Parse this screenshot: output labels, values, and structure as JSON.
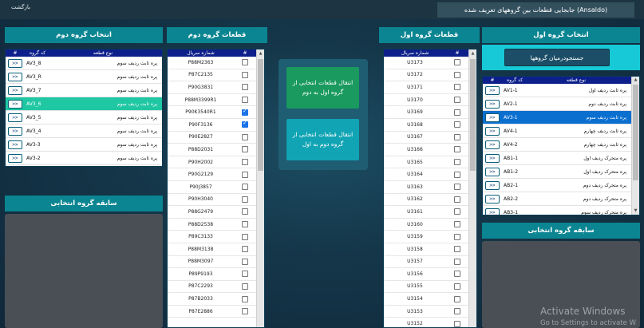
{
  "topbar": {
    "back": "بازگشت",
    "title": "جابجایی قطعات بین گروههای تعریف شده (Ansaldo)"
  },
  "left_group": {
    "header": "انتخاب گروه دوم",
    "columns": [
      "#",
      "کد گروه",
      "نوع قطعه"
    ],
    "rows": [
      {
        "btn": ">>",
        "code": "AV3_8",
        "name": "پره ثابت ردیف سوم"
      },
      {
        "btn": ">>",
        "code": "AV3_R",
        "name": "پره ثابت ردیف سوم"
      },
      {
        "btn": ">>",
        "code": "AV3_7",
        "name": "پره ثابت ردیف سوم"
      },
      {
        "btn": ">>",
        "code": "AV3_6",
        "name": "پره ثابت ردیف سوم"
      },
      {
        "btn": ">>",
        "code": "AV3_5",
        "name": "پره ثابت ردیف سوم"
      },
      {
        "btn": ">>",
        "code": "AV3_4",
        "name": "پره ثابت ردیف سوم"
      },
      {
        "btn": ">>",
        "code": "AV3-3",
        "name": "پره ثابت ردیف سوم"
      },
      {
        "btn": ">>",
        "code": "AV3-2",
        "name": "پره ثابت ردیف سوم"
      }
    ],
    "history_header": "سابقه گروه انتخابی"
  },
  "left_parts": {
    "header": "قطعات گروه دوم",
    "columns": [
      "#",
      "شماره سریال"
    ],
    "rows": [
      {
        "serial": "P88M2363",
        "checked": false
      },
      {
        "serial": "P87C2135",
        "checked": false
      },
      {
        "serial": "P90G3831",
        "checked": false
      },
      {
        "serial": "P88M3399R1",
        "checked": false
      },
      {
        "serial": "P90K3540R1",
        "checked": true
      },
      {
        "serial": "P90F3136",
        "checked": true
      },
      {
        "serial": "P90E2827",
        "checked": false
      },
      {
        "serial": "P88D2031",
        "checked": false
      },
      {
        "serial": "P90H2002",
        "checked": false
      },
      {
        "serial": "P90G2129",
        "checked": false
      },
      {
        "serial": "P90J3857",
        "checked": false
      },
      {
        "serial": "P90H3040",
        "checked": false
      },
      {
        "serial": "P88G2479",
        "checked": false
      },
      {
        "serial": "P88D2538",
        "checked": false
      },
      {
        "serial": "P89C3133",
        "checked": false
      },
      {
        "serial": "P88M3138",
        "checked": false
      },
      {
        "serial": "P88M3097",
        "checked": false
      },
      {
        "serial": "P89P9193",
        "checked": false
      },
      {
        "serial": "P87C2293",
        "checked": false
      },
      {
        "serial": "P87B2033",
        "checked": false
      },
      {
        "serial": "P87E2886",
        "checked": false
      }
    ]
  },
  "middle": {
    "btn_to_second": "انتقال قطعات انتخابی از گروه اول به دوم",
    "btn_to_first": "انتقال قطعات انتخابی از گروه دوم به اول"
  },
  "right_parts": {
    "header": "قطعات گروه اول",
    "columns": [
      "#",
      "شماره سریال"
    ],
    "rows": [
      "U3173",
      "U3172",
      "U3171",
      "U3170",
      "U3169",
      "U3168",
      "U3167",
      "U3166",
      "U3165",
      "U3164",
      "U3163",
      "U3162",
      "U3161",
      "U3160",
      "U3159",
      "U3158",
      "U3157",
      "U3156",
      "U3155",
      "U3154",
      "U3153",
      "U3152"
    ]
  },
  "right_group": {
    "header": "انتخاب گروه اول",
    "search_button": "جستجودرمیان گروهها",
    "columns": [
      "#",
      "کد گروه",
      "نوع قطعه"
    ],
    "rows": [
      {
        "btn": ">>",
        "code": "AV1-1",
        "name": "پره ثابت ردیف اول"
      },
      {
        "btn": ">>",
        "code": "AV2-1",
        "name": "پره ثابت ردیف دوم"
      },
      {
        "btn": ">>",
        "code": "AV3-1",
        "name": "پره ثابت ردیف سوم"
      },
      {
        "btn": ">>",
        "code": "AV4-1",
        "name": "پره ثابت ردیف چهارم"
      },
      {
        "btn": ">>",
        "code": "AV4-2",
        "name": "پره ثابت ردیف چهارم"
      },
      {
        "btn": ">>",
        "code": "AB1-1",
        "name": "پره متحرک ردیف اول"
      },
      {
        "btn": ">>",
        "code": "AB1-2",
        "name": "پره متحرک ردیف اول"
      },
      {
        "btn": ">>",
        "code": "AB2-1",
        "name": "پره متحرک ردیف دوم"
      },
      {
        "btn": ">>",
        "code": "AB2-2",
        "name": "پره متحرک ردیف دوم"
      },
      {
        "btn": ">>",
        "code": "AB3-1",
        "name": "پره متحرک ردیف سوم"
      }
    ],
    "history_header": "سابقه گروه انتخابی"
  },
  "watermark": {
    "title": "Activate Windows",
    "subtitle": "Go to Settings to activate W"
  }
}
